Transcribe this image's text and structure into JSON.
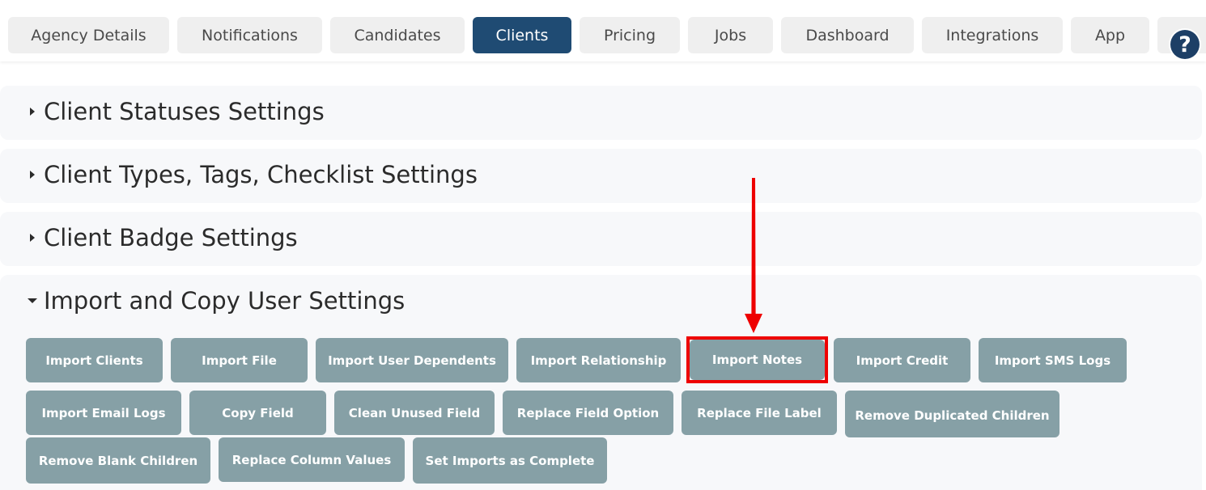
{
  "tabs": [
    {
      "label": "Agency Details",
      "active": false
    },
    {
      "label": "Notifications",
      "active": false
    },
    {
      "label": "Candidates",
      "active": false
    },
    {
      "label": "Clients",
      "active": true
    },
    {
      "label": "Pricing",
      "active": false
    },
    {
      "label": "Jobs",
      "active": false
    },
    {
      "label": "Dashboard",
      "active": false
    },
    {
      "label": "Integrations",
      "active": false
    },
    {
      "label": "App",
      "active": false
    }
  ],
  "help": {
    "label": "?"
  },
  "sections": [
    {
      "title": "Client Statuses Settings",
      "expanded": false
    },
    {
      "title": "Client Types, Tags, Checklist Settings",
      "expanded": false
    },
    {
      "title": "Client Badge Settings",
      "expanded": false
    },
    {
      "title": "Import and Copy User Settings",
      "expanded": true
    }
  ],
  "actions": [
    "Import Clients",
    "Import File",
    "Import User Dependents",
    "Import Relationship",
    "Import Notes",
    "Import Credit",
    "Import SMS Logs",
    "Import Email Logs",
    "Copy Field",
    "Clean Unused Field",
    "Replace Field Option",
    "Replace File Label",
    "Remove Duplicated Children",
    "Remove Blank Children",
    "Replace Column Values",
    "Set Imports as Complete"
  ],
  "colors": {
    "active_tab": "#1f4b73",
    "action_button": "#86a0a6",
    "highlight": "#ee0000",
    "arrow": "#ee0000"
  }
}
